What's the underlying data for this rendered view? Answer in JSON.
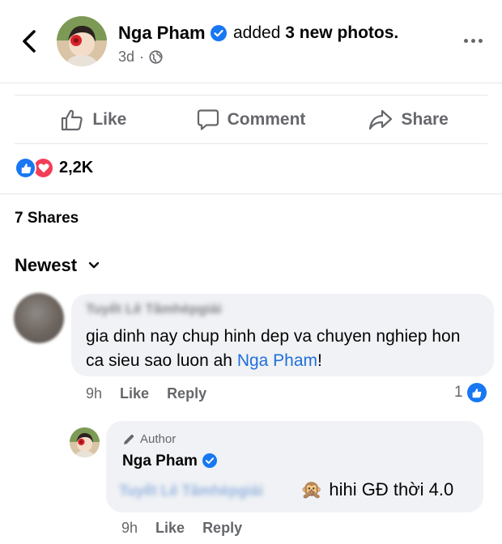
{
  "post": {
    "author": "Nga Pham",
    "action_prefix": "added",
    "action_bold": "3 new photos.",
    "time": "3d",
    "privacy_dot": "·"
  },
  "actions": {
    "like": "Like",
    "comment": "Comment",
    "share": "Share"
  },
  "reactions": {
    "count": "2,2K",
    "types": [
      "like",
      "love"
    ]
  },
  "shares": "7 Shares",
  "sort": {
    "label": "Newest"
  },
  "comments": [
    {
      "name": "Tuyết Lê Tâmhèpgiải",
      "text": "gia dinh nay chup hinh dep va chuyen nghiep hon ca sieu sao luon ah",
      "mention": "Nga Pham",
      "suffix": "!",
      "time": "9h",
      "like": "Like",
      "reply": "Reply",
      "likes": "1"
    }
  ],
  "reply": {
    "badge": "Author",
    "name": "Nga Pham",
    "mention": "Tuyết Lê Tâmhèpgiải",
    "emoji": "🙊",
    "text": "hihi GĐ thời 4.0",
    "time": "9h",
    "like": "Like",
    "reply": "Reply"
  },
  "colors": {
    "accent": "#1877f2",
    "love": "#f33e58",
    "mention": "#216fdb",
    "secondary_text": "#65676b",
    "bubble": "#f0f2f5"
  }
}
